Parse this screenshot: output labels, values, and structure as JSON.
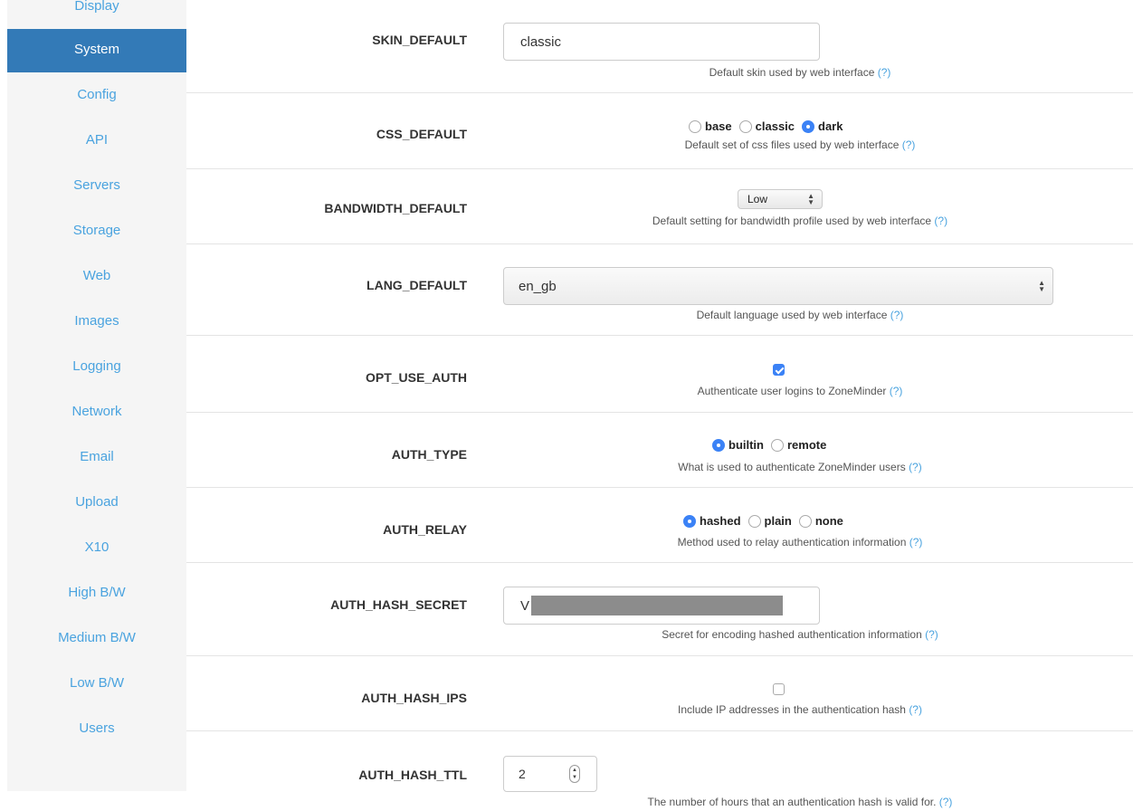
{
  "sidebar": {
    "items": [
      {
        "label": "Display",
        "active": false
      },
      {
        "label": "System",
        "active": true
      },
      {
        "label": "Config",
        "active": false
      },
      {
        "label": "API",
        "active": false
      },
      {
        "label": "Servers",
        "active": false
      },
      {
        "label": "Storage",
        "active": false
      },
      {
        "label": "Web",
        "active": false
      },
      {
        "label": "Images",
        "active": false
      },
      {
        "label": "Logging",
        "active": false
      },
      {
        "label": "Network",
        "active": false
      },
      {
        "label": "Email",
        "active": false
      },
      {
        "label": "Upload",
        "active": false
      },
      {
        "label": "X10",
        "active": false
      },
      {
        "label": "High B/W",
        "active": false
      },
      {
        "label": "Medium B/W",
        "active": false
      },
      {
        "label": "Low B/W",
        "active": false
      },
      {
        "label": "Users",
        "active": false
      }
    ]
  },
  "settings": {
    "skin_default": {
      "label": "SKIN_DEFAULT",
      "value": "classic",
      "help": "Default skin used by web interface",
      "help_link": "(?)"
    },
    "css_default": {
      "label": "CSS_DEFAULT",
      "options": [
        "base",
        "classic",
        "dark"
      ],
      "selected": "dark",
      "help": "Default set of css files used by web interface",
      "help_link": "(?)"
    },
    "bandwidth_default": {
      "label": "BANDWIDTH_DEFAULT",
      "value": "Low",
      "help": "Default setting for bandwidth profile used by web interface",
      "help_link": "(?)"
    },
    "lang_default": {
      "label": "LANG_DEFAULT",
      "value": "en_gb",
      "help": "Default language used by web interface",
      "help_link": "(?)"
    },
    "opt_use_auth": {
      "label": "OPT_USE_AUTH",
      "checked": true,
      "help": "Authenticate user logins to ZoneMinder",
      "help_link": "(?)"
    },
    "auth_type": {
      "label": "AUTH_TYPE",
      "options": [
        "builtin",
        "remote"
      ],
      "selected": "builtin",
      "help": "What is used to authenticate ZoneMinder users",
      "help_link": "(?)"
    },
    "auth_relay": {
      "label": "AUTH_RELAY",
      "options": [
        "hashed",
        "plain",
        "none"
      ],
      "selected": "hashed",
      "help": "Method used to relay authentication information",
      "help_link": "(?)"
    },
    "auth_hash_secret": {
      "label": "AUTH_HASH_SECRET",
      "value_visible": "V",
      "help": "Secret for encoding hashed authentication information",
      "help_link": "(?)"
    },
    "auth_hash_ips": {
      "label": "AUTH_HASH_IPS",
      "checked": false,
      "help": "Include IP addresses in the authentication hash",
      "help_link": "(?)"
    },
    "auth_hash_ttl": {
      "label": "AUTH_HASH_TTL",
      "value": "2",
      "help": "The number of hours that an authentication hash is valid for.",
      "help_link": "(?)"
    }
  },
  "icons": {
    "select_arrows": "updown-arrows-icon",
    "spinner": "number-spinner-icon",
    "checkmark": "checkmark-icon"
  },
  "colors": {
    "accent": "#337ab7",
    "link": "#4aa3df",
    "radio_checked": "#3b82f6"
  }
}
